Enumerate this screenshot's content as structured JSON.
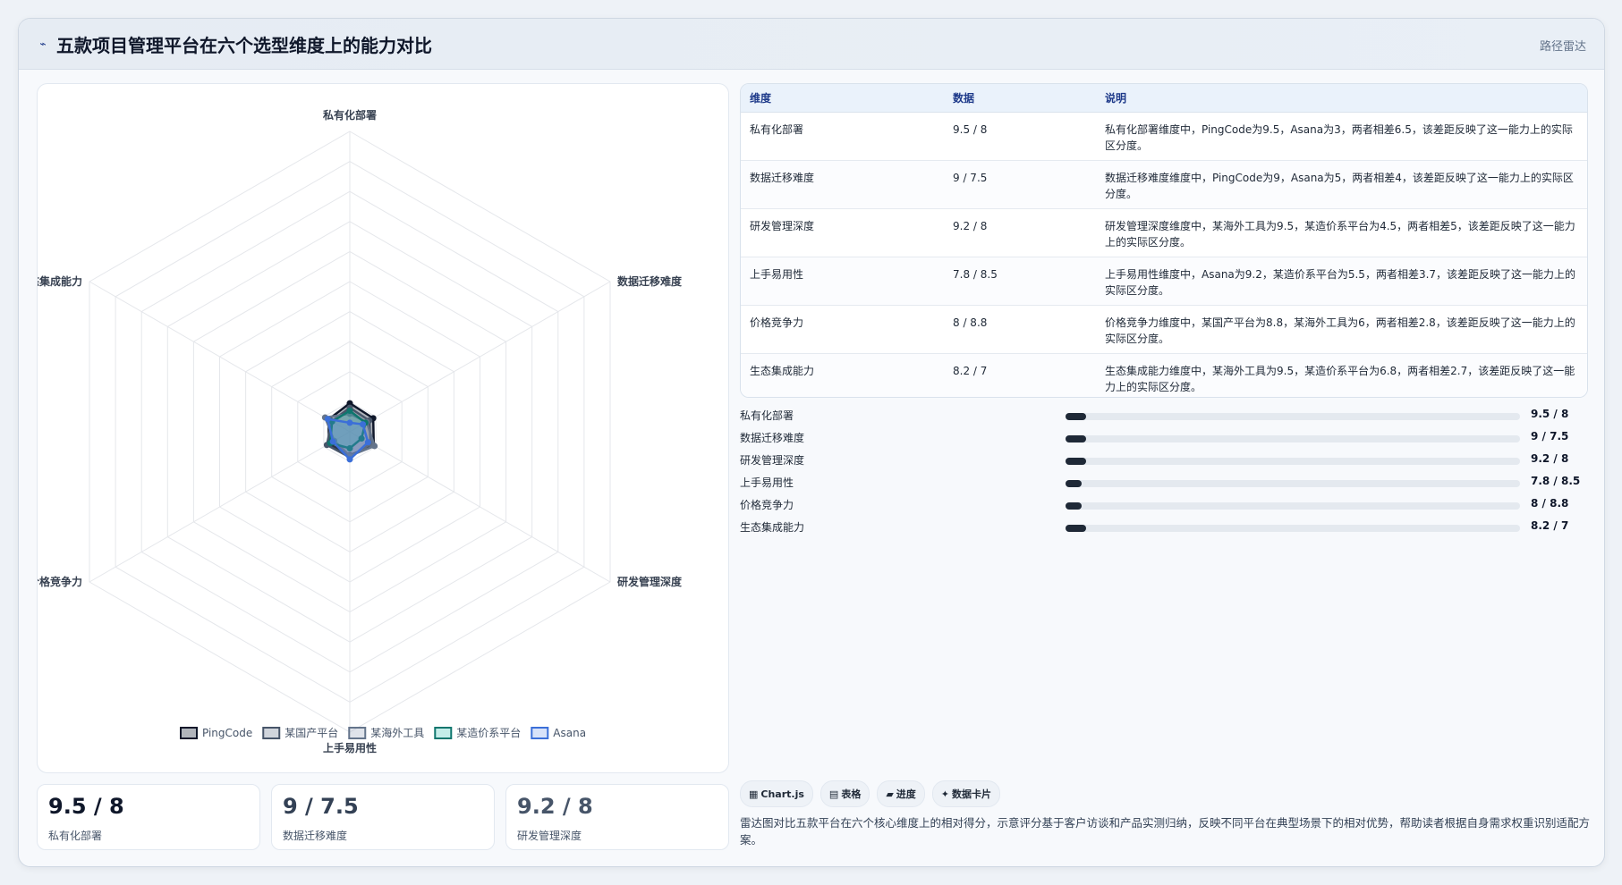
{
  "header": {
    "title": "五款项目管理平台在六个选型维度上的能力对比",
    "tag": "路径雷达"
  },
  "table": {
    "columns": [
      "维度",
      "数据",
      "说明"
    ],
    "rows": [
      {
        "dim": "私有化部署",
        "val": "9.5 / 8",
        "desc": "私有化部署维度中，PingCode为9.5，Asana为3，两者相差6.5，该差距反映了这一能力上的实际区分度。"
      },
      {
        "dim": "数据迁移难度",
        "val": "9 / 7.5",
        "desc": "数据迁移难度维度中，PingCode为9，Asana为5，两者相差4，该差距反映了这一能力上的实际区分度。"
      },
      {
        "dim": "研发管理深度",
        "val": "9.2 / 8",
        "desc": "研发管理深度维度中，某海外工具为9.5，某造价系平台为4.5，两者相差5，该差距反映了这一能力上的实际区分度。"
      },
      {
        "dim": "上手易用性",
        "val": "7.8 / 8.5",
        "desc": "上手易用性维度中，Asana为9.2，某造价系平台为5.5，两者相差3.7，该差距反映了这一能力上的实际区分度。"
      },
      {
        "dim": "价格竞争力",
        "val": "8 / 8.8",
        "desc": "价格竞争力维度中，某国产平台为8.8，某海外工具为6，两者相差2.8，该差距反映了这一能力上的实际区分度。"
      },
      {
        "dim": "生态集成能力",
        "val": "8.2 / 7",
        "desc": "生态集成能力维度中，某海外工具为9.5，某造价系平台为6.8，两者相差2.7，该差距反映了这一能力上的实际区分度。"
      }
    ]
  },
  "progress": [
    {
      "label": "私有化部署",
      "value": "9.5 / 8",
      "fraction": 0.045
    },
    {
      "label": "数据迁移难度",
      "value": "9 / 7.5",
      "fraction": 0.045
    },
    {
      "label": "研发管理深度",
      "value": "9.2 / 8",
      "fraction": 0.045
    },
    {
      "label": "上手易用性",
      "value": "7.8 / 8.5",
      "fraction": 0.035
    },
    {
      "label": "价格竞争力",
      "value": "8 / 8.8",
      "fraction": 0.035
    },
    {
      "label": "生态集成能力",
      "value": "8.2 / 7",
      "fraction": 0.045
    }
  ],
  "kpis": [
    {
      "value": "9.5 / 8",
      "label": "私有化部署"
    },
    {
      "value": "9 / 7.5",
      "label": "数据迁移难度"
    },
    {
      "value": "9.2 / 8",
      "label": "研发管理深度"
    }
  ],
  "chips": [
    {
      "icon": "grid-icon",
      "glyph": "▦",
      "label": "Chart.js"
    },
    {
      "icon": "table-icon",
      "glyph": "▤",
      "label": "表格"
    },
    {
      "icon": "progress-icon",
      "glyph": "▰",
      "label": "进度"
    },
    {
      "icon": "card-icon",
      "glyph": "✦",
      "label": "数据卡片"
    }
  ],
  "caption": "雷达图对比五款平台在六个核心维度上的相对得分，示意评分基于客户访谈和产品实测归纳，反映不同平台在典型场景下的相对优势，帮助读者根据自身需求权重识别适配方案。",
  "chart_data": {
    "type": "radar",
    "categories": [
      "私有化部署",
      "数据迁移难度",
      "研发管理深度",
      "上手易用性",
      "价格竞争力",
      "生态集成能力"
    ],
    "rmax": 100,
    "rings": 10,
    "grid": true,
    "legend_position": "bottom",
    "series": [
      {
        "name": "PingCode",
        "values": [
          9.5,
          9,
          9.2,
          7.8,
          8,
          8.2
        ],
        "stroke": "#0f172a",
        "fill": "rgba(30,41,59,0.35)"
      },
      {
        "name": "某国产平台",
        "values": [
          8,
          7.5,
          8,
          8.5,
          8.8,
          7
        ],
        "stroke": "#475569",
        "fill": "rgba(100,116,139,0.30)"
      },
      {
        "name": "某海外工具",
        "values": [
          6,
          6.5,
          9.5,
          8,
          6,
          9.5
        ],
        "stroke": "#64748b",
        "fill": "rgba(148,163,184,0.30)"
      },
      {
        "name": "某造价系平台",
        "values": [
          7,
          6,
          4.5,
          5.5,
          7.5,
          6.8
        ],
        "stroke": "#0f766e",
        "fill": "rgba(20,184,166,0.25)"
      },
      {
        "name": "Asana",
        "values": [
          3,
          5,
          7,
          9.2,
          6.5,
          8.5
        ],
        "stroke": "#3b6fd8",
        "fill": "rgba(96,140,230,0.25)"
      }
    ]
  }
}
